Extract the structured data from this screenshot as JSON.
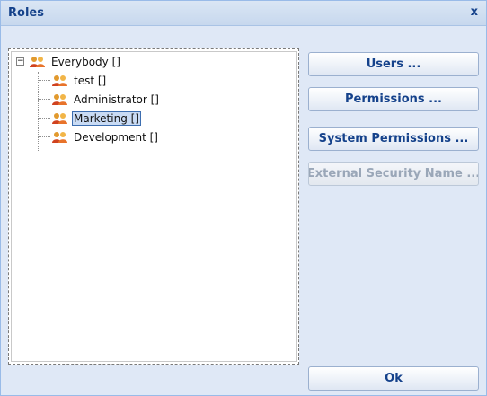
{
  "window": {
    "title": "Roles",
    "close_glyph": "x"
  },
  "tree": {
    "root": {
      "label": "Everybody []",
      "expander": "−",
      "icon": "users-group-icon"
    },
    "children": [
      {
        "label": "test []",
        "icon": "users-group-icon",
        "selected": false
      },
      {
        "label": "Administrator []",
        "icon": "users-group-icon",
        "selected": false
      },
      {
        "label": "Marketing []",
        "icon": "users-group-icon",
        "selected": true
      },
      {
        "label": "Development []",
        "icon": "users-group-icon",
        "selected": false
      }
    ]
  },
  "buttons": {
    "users": "Users ...",
    "permissions": "Permissions ...",
    "system_permissions": "System Permissions ...",
    "external_security_name": "External Security Name ...",
    "ok": "Ok"
  },
  "colors": {
    "accent": "#15428b",
    "panel_bg": "#dfe8f6",
    "selection_bg": "#c9dbf4"
  }
}
